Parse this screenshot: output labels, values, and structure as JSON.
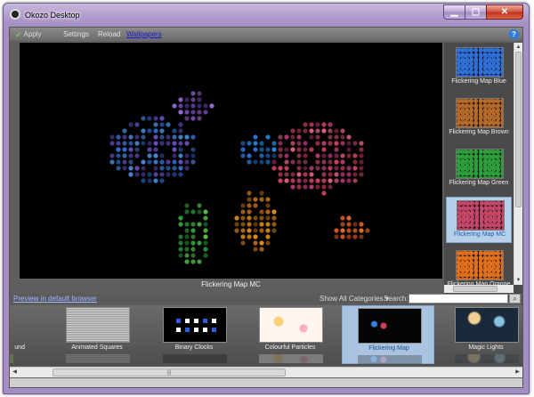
{
  "window": {
    "title": "Okozo Desktop"
  },
  "toolbar": {
    "apply": "Apply",
    "settings": "Settings",
    "reload": "Reload",
    "wallpapers": "Wallpapers"
  },
  "preview": {
    "caption": "Flickering Map MC"
  },
  "thumbnails": [
    {
      "label": "Flickering Map Blue",
      "color": "#2f6fd6"
    },
    {
      "label": "Flickering Map Brown",
      "color": "#b56a2a"
    },
    {
      "label": "Flickering Map Green",
      "color": "#2e9e3c"
    },
    {
      "label": "Flickering Map MC",
      "color": "#c4476a",
      "selected": true
    },
    {
      "label": "Flickering Map Orange",
      "color": "#e0701c"
    }
  ],
  "browse": {
    "preview_link": "Preview in default browser",
    "category": "Show All Categories",
    "search_label": "Search:",
    "search_value": ""
  },
  "gallery": [
    {
      "label": "und"
    },
    {
      "label": "Animated Squares"
    },
    {
      "label": "Binary Clocks"
    },
    {
      "label": "Colourful Particles"
    },
    {
      "label": "Flickering Map",
      "selected": true
    },
    {
      "label": "Magic Lights"
    }
  ],
  "icons": {
    "check": "check-icon",
    "help": "help-icon",
    "search": "search-icon"
  }
}
